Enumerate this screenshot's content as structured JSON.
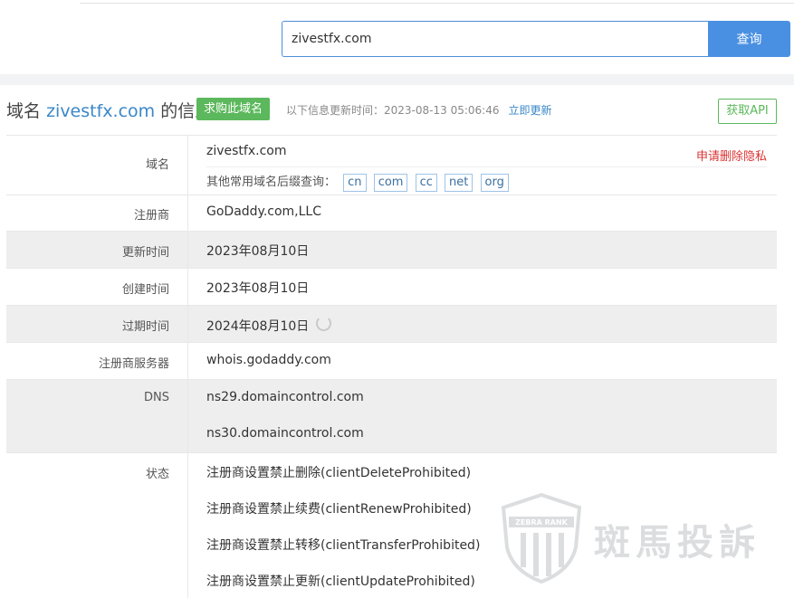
{
  "search": {
    "value": "zivestfx.com",
    "button": "查询"
  },
  "header": {
    "title_prefix": "域名",
    "title_domain": "zivestfx.com",
    "title_suffix": "的信息",
    "buy_button": "求购此域名",
    "update_label": "以下信息更新时间：",
    "update_time": "2023-08-13 05:06:46",
    "update_now": "立即更新",
    "api_button": "获取API"
  },
  "rows": {
    "domain": {
      "key": "域名",
      "value": "zivestfx.com",
      "delete_privacy": "申请删除隐私",
      "suffix_label": "其他常用域名后缀查询：",
      "suffixes": [
        "cn",
        "com",
        "cc",
        "net",
        "org"
      ]
    },
    "registrar": {
      "key": "注册商",
      "value": "GoDaddy.com,LLC"
    },
    "updated": {
      "key": "更新时间",
      "value": "2023年08月10日"
    },
    "created": {
      "key": "创建时间",
      "value": "2023年08月10日"
    },
    "expires": {
      "key": "过期时间",
      "value": "2024年08月10日"
    },
    "whois": {
      "key": "注册商服务器",
      "value": "whois.godaddy.com"
    },
    "dns": {
      "key": "DNS",
      "values": [
        "ns29.domaincontrol.com",
        "ns30.domaincontrol.com"
      ]
    },
    "status": {
      "key": "状态",
      "values": [
        "注册商设置禁止删除(clientDeleteProhibited)",
        "注册商设置禁止续费(clientRenewProhibited)",
        "注册商设置禁止转移(clientTransferProhibited)",
        "注册商设置禁止更新(clientUpdateProhibited)"
      ]
    }
  },
  "watermark": {
    "logo_text": "ZEBRA RANK",
    "text": "斑馬投訴"
  }
}
